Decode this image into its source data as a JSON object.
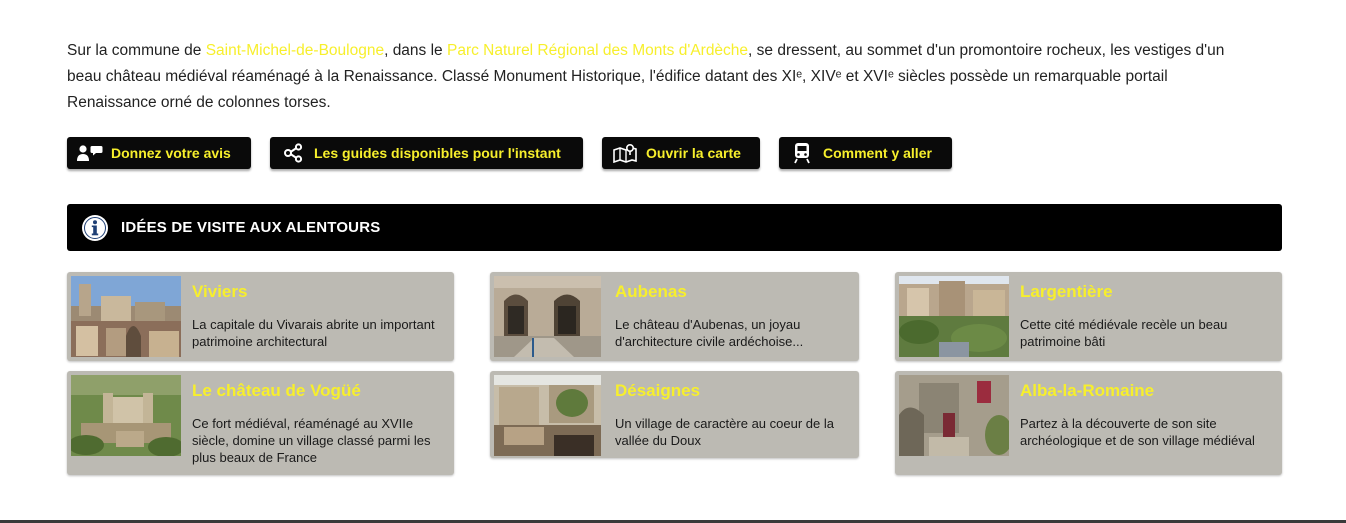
{
  "intro": {
    "part1": "Sur la commune de ",
    "link1": "Saint-Michel-de-Boulogne",
    "part2": ", dans le ",
    "link2": "Parc Naturel Régional des Monts d'Ardèche",
    "part3": ", se dressent, au sommet d'un promontoire rocheux, les vestiges d'un beau château médiéval réaménagé à la Renaissance. Classé Monument Historique, l'édifice datant des XIᵉ, XIVᵉ et XVIᵉ siècles possède un remarquable portail Renaissance orné de colonnes torses."
  },
  "buttons": [
    {
      "label": "Donnez votre avis",
      "icon": "review-icon"
    },
    {
      "label": "Les guides disponibles pour l'instant",
      "icon": "share-icon"
    },
    {
      "label": "Ouvrir la carte",
      "icon": "map-icon"
    },
    {
      "label": "Comment y aller",
      "icon": "train-icon"
    }
  ],
  "section": {
    "title": "IDÉES DE VISITE AUX ALENTOURS",
    "icon": "info-icon"
  },
  "cards": [
    {
      "name": "Viviers",
      "desc": "La capitale du Vivarais abrite un important patrimoine architectural"
    },
    {
      "name": "Aubenas",
      "desc": "Le château d'Aubenas, un joyau d'architecture civile ardéchoise..."
    },
    {
      "name": "Largentière",
      "desc": "Cette cité médiévale recèle un beau patrimoine bâti"
    },
    {
      "name": "Le château de Vogüé",
      "desc": "Ce fort médiéval, réaménagé au XVIIe siècle, domine un village classé parmi les plus beaux de France"
    },
    {
      "name": "Désaignes",
      "desc": "Un village de caractère au coeur de la vallée du Doux"
    },
    {
      "name": "Alba-la-Romaine",
      "desc": "Partez à la découverte de son site archéologique et de son village médiéval"
    }
  ],
  "colors": {
    "accent": "#f7ef2c",
    "button_bg": "#0a0a0a",
    "card_bg": "#bcbab3",
    "section_bg": "#000000"
  }
}
